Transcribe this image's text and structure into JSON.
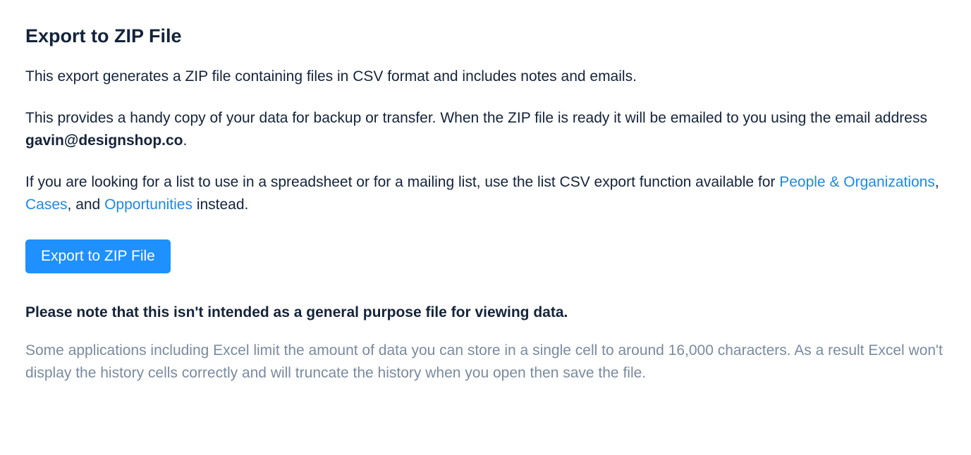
{
  "heading": "Export to ZIP File",
  "paragraph1": "This export generates a ZIP file containing files in CSV format and includes notes and emails.",
  "paragraph2_prefix": "This provides a handy copy of your data for backup or transfer. When the ZIP file is ready it will be emailed to you using the email address ",
  "email": "gavin@designshop.co",
  "paragraph2_suffix": ".",
  "paragraph3_prefix": "If you are looking for a list to use in a spreadsheet or for a mailing list, use the list CSV export function available for ",
  "link_people": "People & Organizations",
  "sep1": ", ",
  "link_cases": "Cases",
  "sep2": ", and ",
  "link_opportunities": "Opportunities",
  "paragraph3_suffix": " instead.",
  "button_label": "Export to ZIP File",
  "note_heading": "Please note that this isn't intended as a general purpose file for viewing data.",
  "note_body": "Some applications including Excel limit the amount of data you can store in a single cell to around 16,000 characters. As a result Excel won't display the history cells correctly and will truncate the history when you open then save the file."
}
